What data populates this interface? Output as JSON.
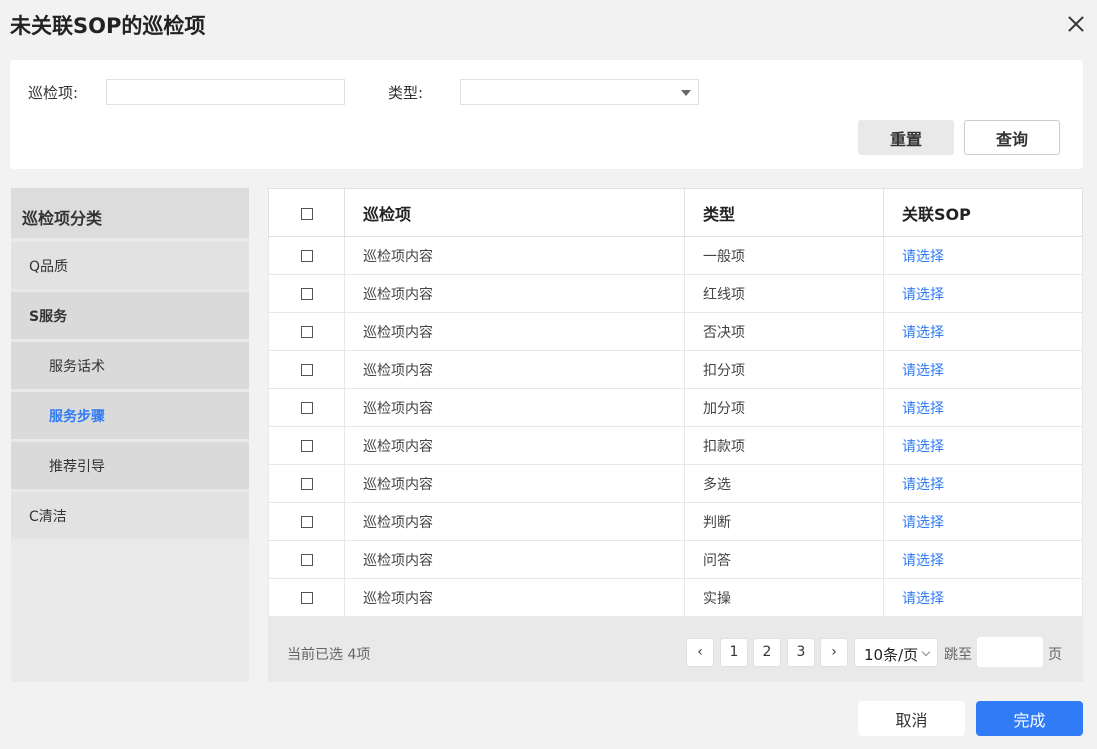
{
  "dialog": {
    "title": "未关联SOP的巡检项"
  },
  "filter": {
    "item_label": "巡检项:",
    "item_value": "",
    "type_label": "类型:",
    "type_value": "",
    "reset_label": "重置",
    "query_label": "查询"
  },
  "sidebar": {
    "header": "巡检项分类",
    "items": [
      {
        "label": "Q品质"
      },
      {
        "label": "S服务"
      },
      {
        "label": "服务话术"
      },
      {
        "label": "服务步骤"
      },
      {
        "label": "推荐引导"
      },
      {
        "label": "C清洁"
      }
    ],
    "active_color": "#2f7cf6"
  },
  "table": {
    "columns": [
      "",
      "巡检项",
      "类型",
      "关联SOP"
    ],
    "rows": [
      {
        "item": "巡检项内容",
        "type": "一般项",
        "sop": "请选择"
      },
      {
        "item": "巡检项内容",
        "type": "红线项",
        "sop": "请选择"
      },
      {
        "item": "巡检项内容",
        "type": "否决项",
        "sop": "请选择"
      },
      {
        "item": "巡检项内容",
        "type": "扣分项",
        "sop": "请选择"
      },
      {
        "item": "巡检项内容",
        "type": "加分项",
        "sop": "请选择"
      },
      {
        "item": "巡检项内容",
        "type": "扣款项",
        "sop": "请选择"
      },
      {
        "item": "巡检项内容",
        "type": "多选",
        "sop": "请选择"
      },
      {
        "item": "巡检项内容",
        "type": "判断",
        "sop": "请选择"
      },
      {
        "item": "巡检项内容",
        "type": "问答",
        "sop": "请选择"
      },
      {
        "item": "巡检项内容",
        "type": "实操",
        "sop": "请选择"
      }
    ]
  },
  "footer": {
    "selected_info": "当前已选 4项",
    "prev_icon": "‹",
    "next_icon": "›",
    "pages": [
      "1",
      "2",
      "3"
    ],
    "page_size": "10条/页",
    "jump_label": "跳至",
    "jump_value": "",
    "page_unit": "页"
  },
  "actions": {
    "cancel_label": "取消",
    "done_label": "完成"
  },
  "colors": {
    "accent": "#2f7cf6"
  }
}
